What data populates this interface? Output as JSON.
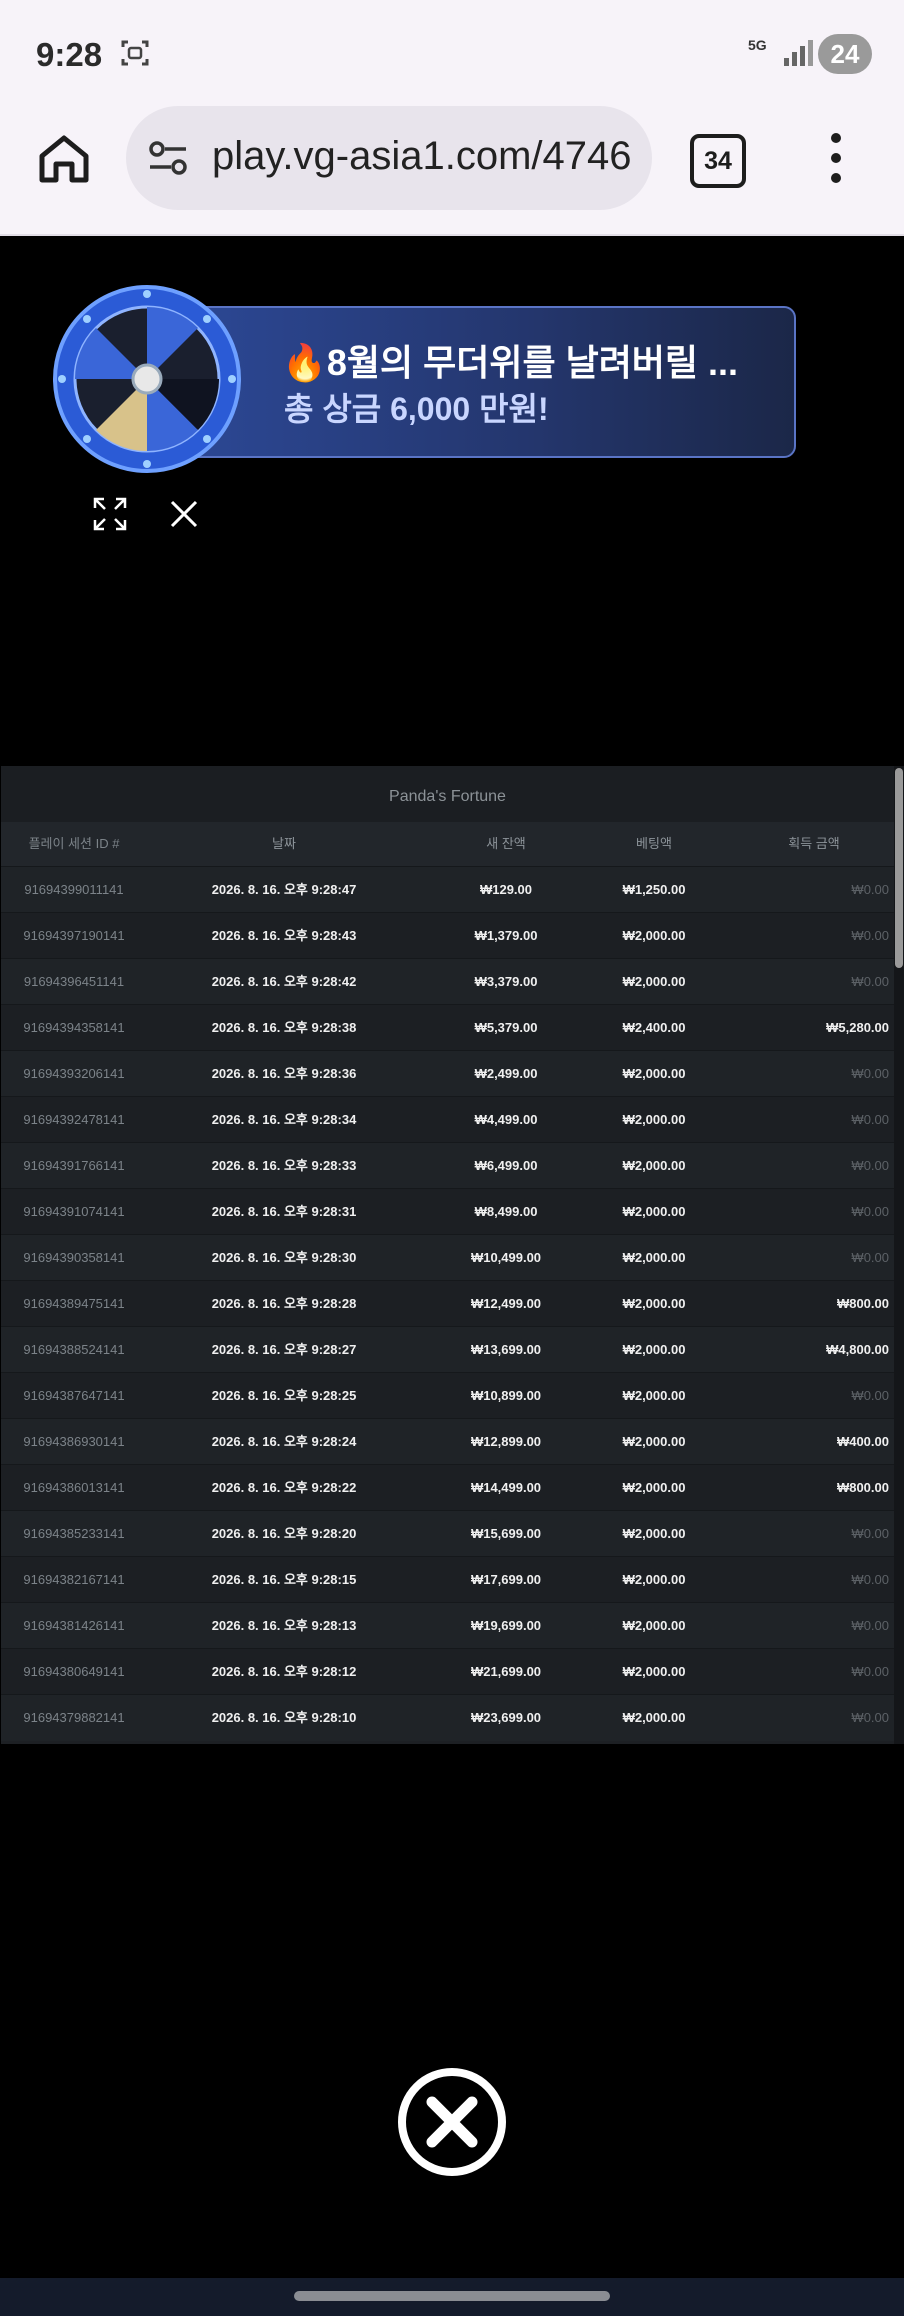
{
  "status_bar": {
    "time": "9:28",
    "network": "5G",
    "battery": "24"
  },
  "browser": {
    "url": "play.vg-asia1.com/4746",
    "tab_count": "34"
  },
  "banner": {
    "title": "🔥8월의 무더위를 날려버릴 ...",
    "subtitle": "총 상금 6,000 만원!"
  },
  "table": {
    "title": "Panda's Fortune",
    "headers": [
      "플레이 세션 ID #",
      "날짜",
      "새 잔액",
      "베팅액",
      "획득 금액"
    ],
    "rows": [
      {
        "id": "91694399011141",
        "date": "2026. 8. 16. 오후 9:28:47",
        "balance": "₩129.00",
        "bet": "₩1,250.00",
        "win": "₩0.00"
      },
      {
        "id": "91694397190141",
        "date": "2026. 8. 16. 오후 9:28:43",
        "balance": "₩1,379.00",
        "bet": "₩2,000.00",
        "win": "₩0.00"
      },
      {
        "id": "91694396451141",
        "date": "2026. 8. 16. 오후 9:28:42",
        "balance": "₩3,379.00",
        "bet": "₩2,000.00",
        "win": "₩0.00"
      },
      {
        "id": "91694394358141",
        "date": "2026. 8. 16. 오후 9:28:38",
        "balance": "₩5,379.00",
        "bet": "₩2,400.00",
        "win": "₩5,280.00"
      },
      {
        "id": "91694393206141",
        "date": "2026. 8. 16. 오후 9:28:36",
        "balance": "₩2,499.00",
        "bet": "₩2,000.00",
        "win": "₩0.00"
      },
      {
        "id": "91694392478141",
        "date": "2026. 8. 16. 오후 9:28:34",
        "balance": "₩4,499.00",
        "bet": "₩2,000.00",
        "win": "₩0.00"
      },
      {
        "id": "91694391766141",
        "date": "2026. 8. 16. 오후 9:28:33",
        "balance": "₩6,499.00",
        "bet": "₩2,000.00",
        "win": "₩0.00"
      },
      {
        "id": "91694391074141",
        "date": "2026. 8. 16. 오후 9:28:31",
        "balance": "₩8,499.00",
        "bet": "₩2,000.00",
        "win": "₩0.00"
      },
      {
        "id": "91694390358141",
        "date": "2026. 8. 16. 오후 9:28:30",
        "balance": "₩10,499.00",
        "bet": "₩2,000.00",
        "win": "₩0.00"
      },
      {
        "id": "91694389475141",
        "date": "2026. 8. 16. 오후 9:28:28",
        "balance": "₩12,499.00",
        "bet": "₩2,000.00",
        "win": "₩800.00"
      },
      {
        "id": "91694388524141",
        "date": "2026. 8. 16. 오후 9:28:27",
        "balance": "₩13,699.00",
        "bet": "₩2,000.00",
        "win": "₩4,800.00"
      },
      {
        "id": "91694387647141",
        "date": "2026. 8. 16. 오후 9:28:25",
        "balance": "₩10,899.00",
        "bet": "₩2,000.00",
        "win": "₩0.00"
      },
      {
        "id": "91694386930141",
        "date": "2026. 8. 16. 오후 9:28:24",
        "balance": "₩12,899.00",
        "bet": "₩2,000.00",
        "win": "₩400.00"
      },
      {
        "id": "91694386013141",
        "date": "2026. 8. 16. 오후 9:28:22",
        "balance": "₩14,499.00",
        "bet": "₩2,000.00",
        "win": "₩800.00"
      },
      {
        "id": "91694385233141",
        "date": "2026. 8. 16. 오후 9:28:20",
        "balance": "₩15,699.00",
        "bet": "₩2,000.00",
        "win": "₩0.00"
      },
      {
        "id": "91694382167141",
        "date": "2026. 8. 16. 오후 9:28:15",
        "balance": "₩17,699.00",
        "bet": "₩2,000.00",
        "win": "₩0.00"
      },
      {
        "id": "91694381426141",
        "date": "2026. 8. 16. 오후 9:28:13",
        "balance": "₩19,699.00",
        "bet": "₩2,000.00",
        "win": "₩0.00"
      },
      {
        "id": "91694380649141",
        "date": "2026. 8. 16. 오후 9:28:12",
        "balance": "₩21,699.00",
        "bet": "₩2,000.00",
        "win": "₩0.00"
      },
      {
        "id": "91694379882141",
        "date": "2026. 8. 16. 오후 9:28:10",
        "balance": "₩23,699.00",
        "bet": "₩2,000.00",
        "win": "₩0.00"
      }
    ]
  }
}
